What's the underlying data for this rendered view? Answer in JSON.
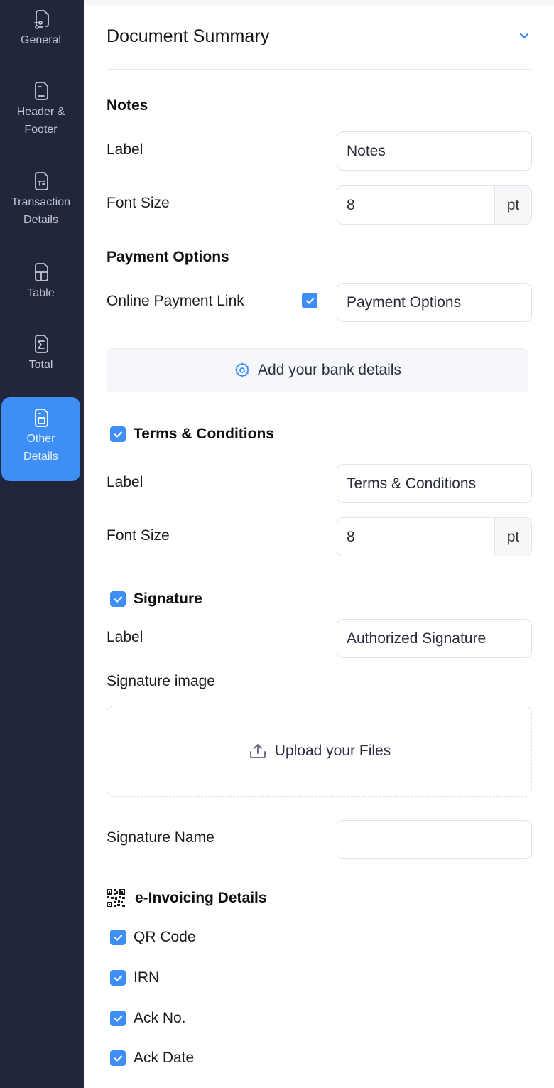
{
  "sidebar": {
    "items": [
      {
        "label_line1": "General",
        "label_line2": "",
        "icon": "document-settings-icon",
        "active": false
      },
      {
        "label_line1": "Header &",
        "label_line2": "Footer",
        "icon": "document-header-footer-icon",
        "active": false
      },
      {
        "label_line1": "Transaction",
        "label_line2": "Details",
        "icon": "document-text-icon",
        "active": false
      },
      {
        "label_line1": "Table",
        "label_line2": "",
        "icon": "document-table-icon",
        "active": false
      },
      {
        "label_line1": "Total",
        "label_line2": "",
        "icon": "document-sigma-icon",
        "active": false
      },
      {
        "label_line1": "Other",
        "label_line2": "Details",
        "icon": "document-box-icon",
        "active": true
      }
    ]
  },
  "colors": {
    "sidebar_bg": "#21263c",
    "accent": "#3d8ef5",
    "text": "#1a1a1a"
  },
  "panel": {
    "title": "Document Summary",
    "collapse_icon": "chevron-down-icon"
  },
  "notes": {
    "heading": "Notes",
    "label_caption": "Label",
    "label_value": "Notes",
    "font_size_caption": "Font Size",
    "font_size_value": "8",
    "font_size_unit": "pt"
  },
  "payment": {
    "heading": "Payment Options",
    "online_link_caption": "Online Payment Link",
    "online_link_checked": true,
    "online_link_value": "Payment Options",
    "bank_button_label": "Add your bank details",
    "bank_button_icon": "gear-icon"
  },
  "terms": {
    "heading": "Terms & Conditions",
    "checked": true,
    "label_caption": "Label",
    "label_value": "Terms & Conditions",
    "font_size_caption": "Font Size",
    "font_size_value": "8",
    "font_size_unit": "pt"
  },
  "signature": {
    "heading": "Signature",
    "checked": true,
    "label_caption": "Label",
    "label_value": "Authorized Signature",
    "image_caption": "Signature image",
    "upload_label": "Upload your Files",
    "upload_icon": "upload-icon",
    "name_caption": "Signature Name",
    "name_value": ""
  },
  "einvoicing": {
    "heading": "e-Invoicing Details",
    "icon": "qr-code-icon",
    "options": [
      {
        "label": "QR Code",
        "checked": true
      },
      {
        "label": "IRN",
        "checked": true
      },
      {
        "label": "Ack No.",
        "checked": true
      },
      {
        "label": "Ack Date",
        "checked": true
      }
    ]
  }
}
